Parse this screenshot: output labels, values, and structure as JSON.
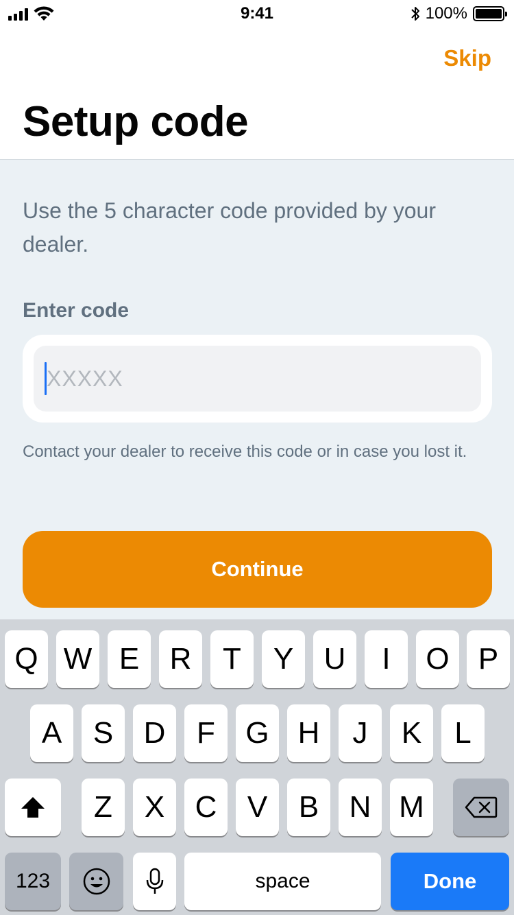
{
  "status_bar": {
    "time": "9:41",
    "battery": "100%"
  },
  "header": {
    "skip_label": "Skip",
    "title": "Setup code"
  },
  "main": {
    "description": "Use the 5 character code provided by your dealer.",
    "field_label": "Enter code",
    "code_input": {
      "value": "",
      "placeholder": "XXXXX"
    },
    "helper_text": "Contact your dealer to receive this code or in case you lost it.",
    "continue_label": "Continue"
  },
  "keyboard": {
    "row1": [
      "Q",
      "W",
      "E",
      "R",
      "T",
      "Y",
      "U",
      "I",
      "O",
      "P"
    ],
    "row2": [
      "A",
      "S",
      "D",
      "F",
      "G",
      "H",
      "J",
      "K",
      "L"
    ],
    "row3": [
      "Z",
      "X",
      "C",
      "V",
      "B",
      "N",
      "M"
    ],
    "numbers_label": "123",
    "space_label": "space",
    "done_label": "Done"
  },
  "colors": {
    "accent": "#ec8a03",
    "background": "#ebf1f5",
    "done_key": "#1a7af8",
    "caret": "#1a6ff5"
  },
  "icons": {
    "status": [
      "signal-icon",
      "wifi-icon",
      "bluetooth-icon",
      "battery-icon"
    ],
    "keyboard": [
      "shift-icon",
      "backspace-icon",
      "emoji-icon",
      "microphone-icon"
    ]
  }
}
